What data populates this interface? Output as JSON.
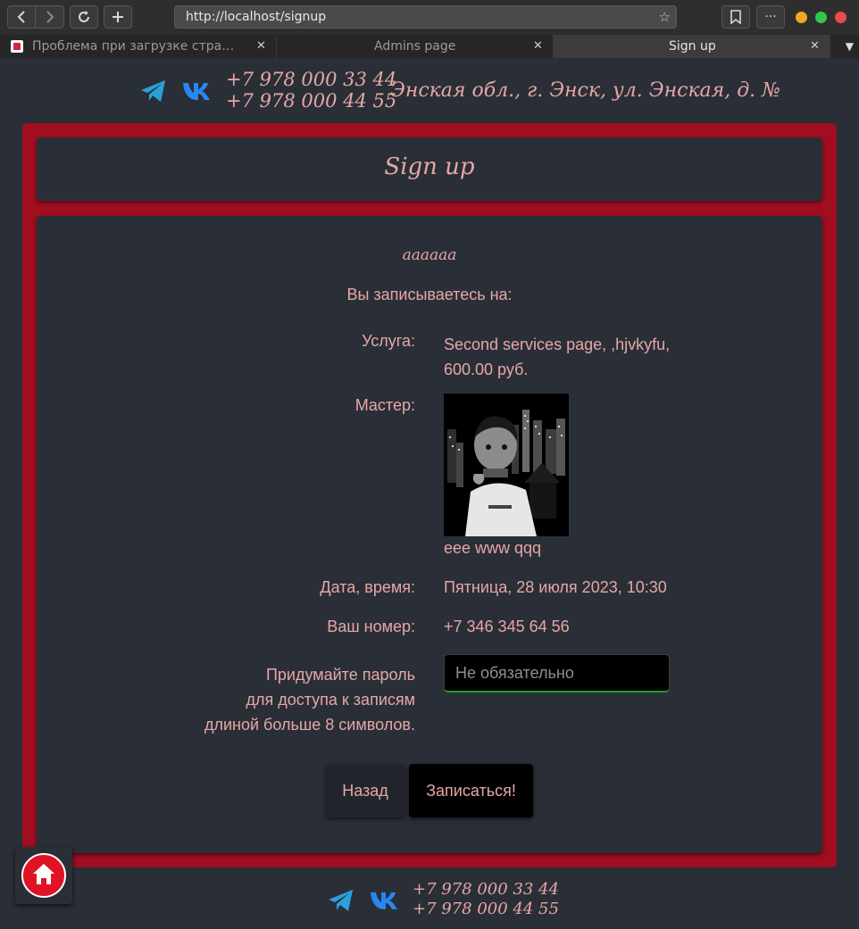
{
  "browser": {
    "url": "http://localhost/signup",
    "tabs": [
      {
        "label": "Проблема при загрузке стра…",
        "active": false
      },
      {
        "label": "Admins page",
        "active": false
      },
      {
        "label": "Sign up",
        "active": true
      }
    ],
    "icons": [
      "back-icon",
      "forward-icon",
      "reload-icon",
      "new-tab-icon",
      "bookmark-star-icon",
      "bookmarks-icon",
      "more-icon",
      "tab-close-icon",
      "tabs-dropdown-icon"
    ],
    "window_dot_colors": [
      "#f4a81e",
      "#33c748",
      "#ed4b4b"
    ]
  },
  "header": {
    "phone1": "+7 978 000 33 44",
    "phone2": "+7 978 000 44 55",
    "address": "Энская обл., г. Энск, ул. Энская, д. №"
  },
  "page": {
    "title": "Sign up",
    "name": "аааааа",
    "intro": "Вы записываетесь на:",
    "service_label": "Услуга:",
    "service_value_line1": "Second services page, ,hjvkyfu,",
    "service_value_line2": "600.00 руб.",
    "master_label": "Мастер:",
    "master_name": "eee www qqq",
    "datetime_label": "Дата, время:",
    "datetime_value": "Пятница, 28 июля 2023, 10:30",
    "phone_label": "Ваш номер:",
    "phone_value": "+7 346 345 64 56",
    "password_label_line1": "Придумайте пароль",
    "password_label_line2": "для доступа к записям",
    "password_label_line3": "длиной больше 8 символов.",
    "password_placeholder": "Не обязательно",
    "back_button": "Назад",
    "submit_button": "Записаться!"
  },
  "footer": {
    "phone1": "+7 978 000 33 44",
    "phone2": "+7 978 000 44 55"
  },
  "colors": {
    "accent_text": "#e7a6a7",
    "frame_red": "#a00e20",
    "background": "#2a2f37",
    "telegram_blue": "#2aa1db",
    "vk_blue": "#2787f5",
    "home_red": "#e01224"
  }
}
